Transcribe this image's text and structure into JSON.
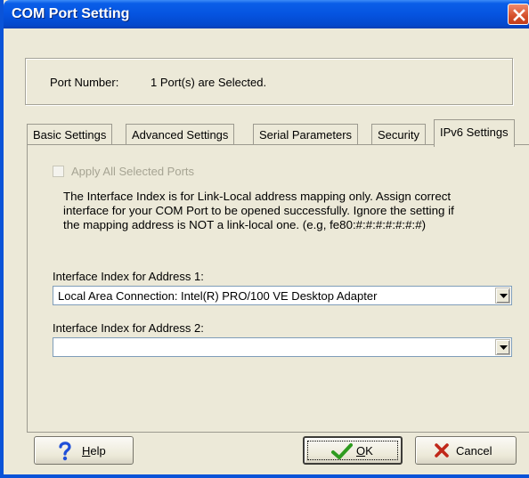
{
  "window": {
    "title": "COM Port Setting"
  },
  "port": {
    "label": "Port Number:",
    "value": "1 Port(s) are Selected."
  },
  "tabs": [
    {
      "label": "Basic Settings",
      "active": false
    },
    {
      "label": "Advanced Settings",
      "active": false
    },
    {
      "label": "Serial Parameters",
      "active": false
    },
    {
      "label": "Security",
      "active": false
    },
    {
      "label": "IPv6 Settings",
      "active": true
    }
  ],
  "ipv6": {
    "apply_all_label": "Apply All Selected Ports",
    "apply_all_checked": false,
    "apply_all_enabled": false,
    "info_lines": [
      "The Interface Index is for Link-Local address mapping only. Assign correct",
      "interface for your COM Port to be opened successfully. Ignore the setting if",
      "the mapping address is NOT a link-local one. (e.g, fe80:#:#:#:#:#:#:#)"
    ],
    "address1_label": "Interface Index for Address 1:",
    "address1_value": "Local Area Connection: Intel(R) PRO/100 VE Desktop Adapter",
    "address2_label": "Interface Index for Address 2:",
    "address2_value": ""
  },
  "buttons": {
    "help_prefix": "",
    "help_underlined": "H",
    "help_rest": "elp",
    "ok_underlined": "O",
    "ok_rest": "K",
    "cancel": "Cancel"
  },
  "colors": {
    "title_bar": "#0554e0",
    "dialog_bg": "#ece9d8",
    "help_icon": "#1f4fd8",
    "ok_check": "#2e9b1f",
    "cancel_x": "#c0281a"
  },
  "icons": {
    "close": "close-icon",
    "help": "help-question-icon",
    "ok": "checkmark-icon",
    "cancel": "x-mark-icon",
    "dropdown": "chevron-down-icon"
  }
}
